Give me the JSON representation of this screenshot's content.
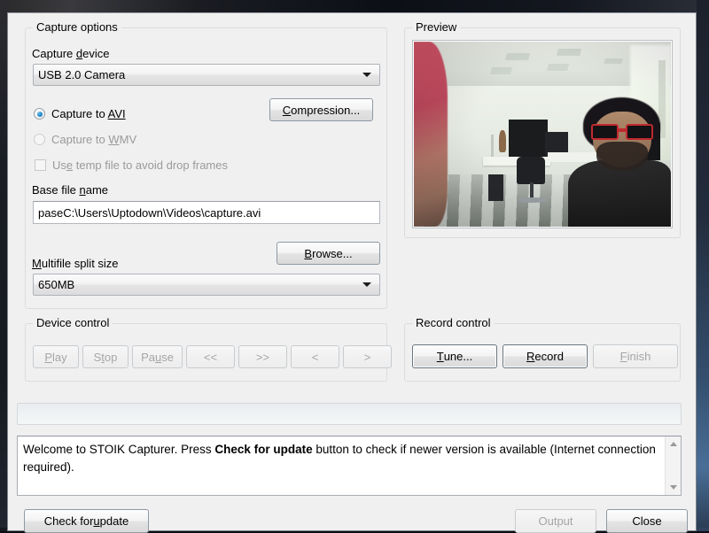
{
  "dialog": {
    "capture_options": {
      "title": "Capture options",
      "device_label": "Capture device",
      "device_label_pre": "Capture ",
      "device_label_accel": "d",
      "device_label_post": "evice",
      "device_value": "USB 2.0 Camera",
      "device_options": [
        "USB 2.0 Camera"
      ],
      "radio_avi": {
        "pre": "Capture to ",
        "accel": "AVI",
        "post": "",
        "checked": true,
        "enabled": true
      },
      "radio_wmv": {
        "pre": "Capture to ",
        "accel": "W",
        "post": "MV",
        "checked": false,
        "enabled": false
      },
      "checkbox_temp": {
        "pre": "Us",
        "accel": "e",
        "post": " temp file to avoid drop frames",
        "checked": false,
        "enabled": false
      },
      "compression_button": {
        "pre": "",
        "accel": "C",
        "post": "ompression..."
      },
      "base_file_label": {
        "pre": "Base file ",
        "accel": "n",
        "post": "ame"
      },
      "base_file_value": "paseC:\\Users\\Uptodown\\Videos\\capture.avi",
      "base_file_placeholder": "Base file name",
      "browse_button": {
        "pre": "",
        "accel": "B",
        "post": "rowse..."
      },
      "split_label": {
        "pre": "",
        "accel": "M",
        "post": "ultifile split size"
      },
      "split_value": "650MB",
      "split_options": [
        "650MB"
      ]
    },
    "preview": {
      "title": "Preview",
      "alt": "Live webcam preview: man wearing red sunglasses in a bright office with desks, monitors and a checkered floor"
    },
    "device_control": {
      "title": "Device control",
      "buttons": [
        {
          "pre": "",
          "accel": "P",
          "post": "lay",
          "enabled": false
        },
        {
          "pre": "S",
          "accel": "t",
          "post": "op",
          "enabled": false
        },
        {
          "pre": "Pa",
          "accel": "u",
          "post": "se",
          "enabled": false
        },
        {
          "pre": "<<",
          "accel": "",
          "post": "",
          "enabled": false
        },
        {
          "pre": ">>",
          "accel": "",
          "post": "",
          "enabled": false
        },
        {
          "pre": "<",
          "accel": "",
          "post": "",
          "enabled": false
        },
        {
          "pre": ">",
          "accel": "",
          "post": "",
          "enabled": false
        }
      ]
    },
    "record_control": {
      "title": "Record control",
      "buttons": [
        {
          "pre": "",
          "accel": "T",
          "post": "une...",
          "enabled": true
        },
        {
          "pre": "",
          "accel": "R",
          "post": "ecord",
          "enabled": true
        },
        {
          "pre": "",
          "accel": "F",
          "post": "inish",
          "enabled": false
        }
      ]
    },
    "progress": {
      "value": 0,
      "max": 100
    },
    "message": {
      "part1": "Welcome to STOIK Capturer. Press ",
      "bold": "Check for update",
      "part2": " button to check if newer version is available (Internet connection required)."
    },
    "footer": {
      "check_update": {
        "pre": "Check for ",
        "accel": "u",
        "post": "pdate",
        "enabled": true
      },
      "output": {
        "pre": "Output",
        "accel": "",
        "post": "",
        "enabled": false
      },
      "close": {
        "pre": "Close",
        "accel": "",
        "post": "",
        "enabled": true
      }
    }
  }
}
